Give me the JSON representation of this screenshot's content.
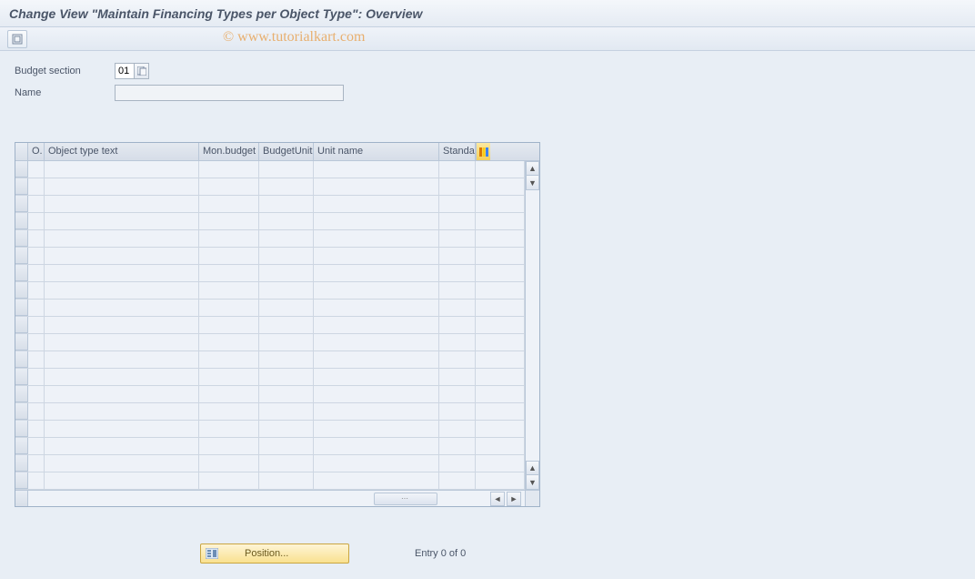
{
  "title": "Change View \"Maintain Financing Types per Object Type\": Overview",
  "watermark": "© www.tutorialkart.com",
  "form": {
    "budget_section_label": "Budget section",
    "budget_section_value": "01",
    "name_label": "Name",
    "name_value": ""
  },
  "table": {
    "columns": {
      "o": "O.",
      "object_type_text": "Object type text",
      "mon_budget": "Mon.budget",
      "budget_unit": "BudgetUnit",
      "unit_name": "Unit name",
      "standard": "Standa"
    },
    "rows": []
  },
  "footer": {
    "position_label": "Position...",
    "entry_text": "Entry 0 of 0"
  }
}
